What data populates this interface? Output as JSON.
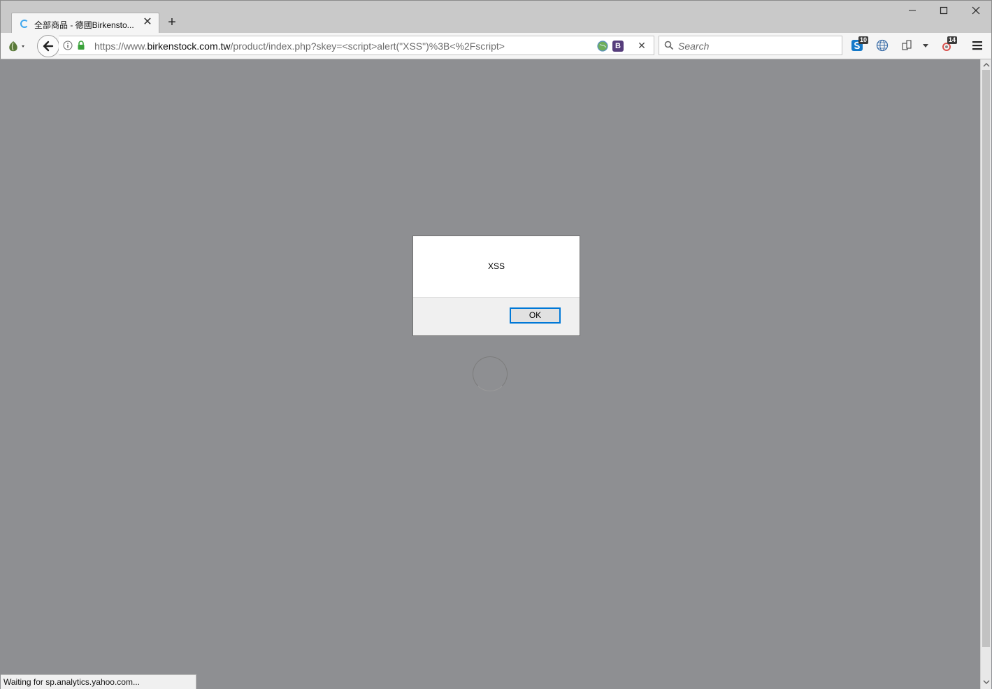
{
  "tab": {
    "title": "全部商品 - 德國Birkensto...",
    "new_tab_label": "+",
    "close_glyph": "✕"
  },
  "window_controls": {
    "minimize": "—",
    "maximize": "☐",
    "close": "✕"
  },
  "urlbar": {
    "prefix": "https://www.",
    "host": "birkenstock.com.tw",
    "path": "/product/index.php?skey=<script>alert(\"XSS\")%3B<%2Fscript>",
    "stop_glyph": "✕",
    "extension_b_label": "B"
  },
  "searchbar": {
    "placeholder": "Search"
  },
  "toolbar": {
    "skype_badge": "10",
    "addon_badge": "14"
  },
  "dialog": {
    "message": "XSS",
    "ok_label": "OK"
  },
  "status": {
    "text": "Waiting for sp.analytics.yahoo.com..."
  },
  "colors": {
    "overlay": "#8e8f92",
    "accent": "#0078d7",
    "secure_lock": "#3ba23b"
  }
}
